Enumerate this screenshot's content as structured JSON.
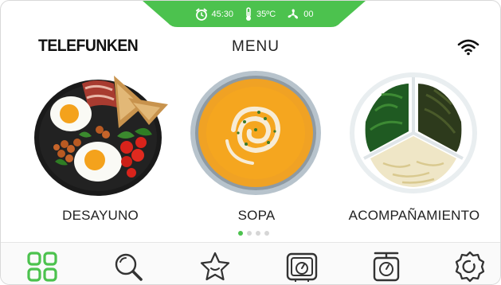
{
  "header": {
    "brand": "TELEFUNKEN",
    "title": "MENU"
  },
  "status_bar": {
    "time": "45:30",
    "temperature": "35ºC",
    "fan": "00",
    "color": "#4cc24e"
  },
  "cards": [
    {
      "label": "DESAYUNO"
    },
    {
      "label": "SOPA"
    },
    {
      "label": "ACOMPAÑAMIENTO"
    }
  ],
  "pagination": {
    "total": 4,
    "active": 1
  },
  "nav": {
    "items": [
      {
        "icon": "grid-icon",
        "active": true
      },
      {
        "icon": "search-icon",
        "active": false
      },
      {
        "icon": "star-icon",
        "active": false
      },
      {
        "icon": "oven-icon",
        "active": false
      },
      {
        "icon": "scale-icon",
        "active": false
      },
      {
        "icon": "gear-icon",
        "active": false
      }
    ],
    "active_color": "#4cc24e",
    "icon_color": "#333333"
  }
}
